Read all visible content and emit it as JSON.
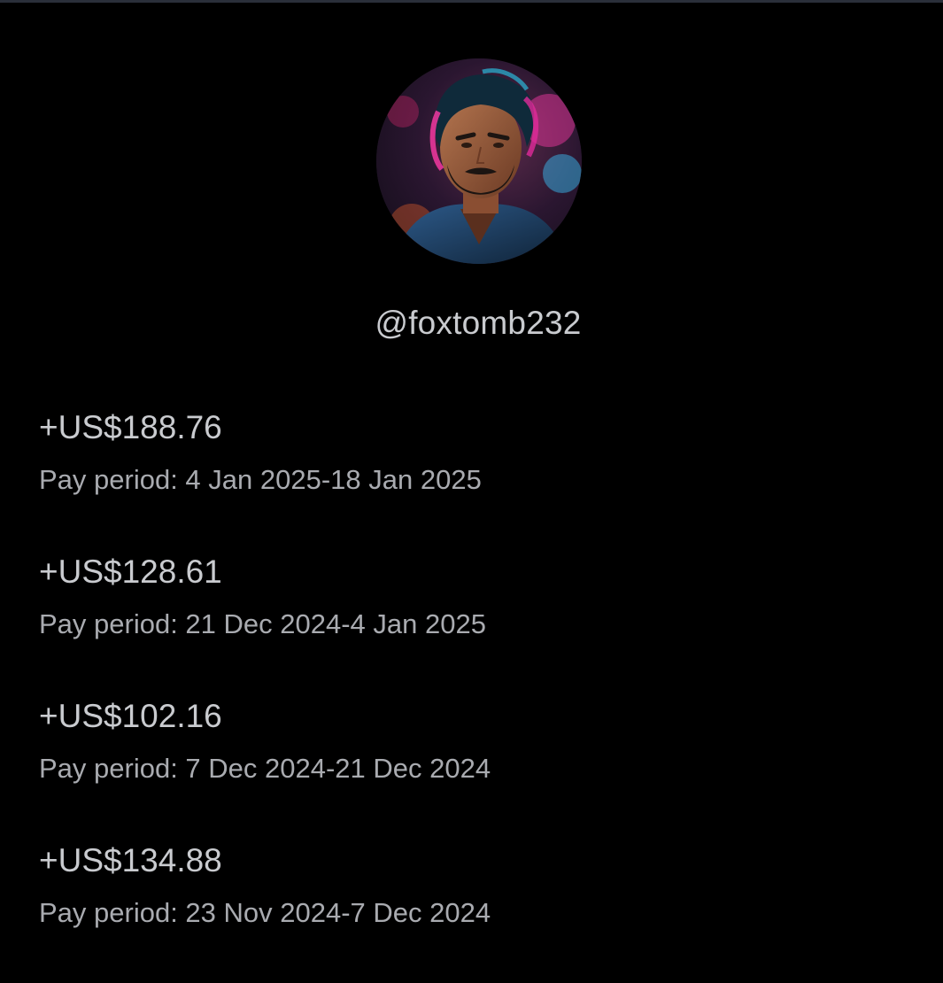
{
  "profile": {
    "avatar_icon": "avatar-illustration",
    "username": "@foxtomb232"
  },
  "payouts": [
    {
      "amount": "+US$188.76",
      "period": "Pay period: 4 Jan 2025-18 Jan 2025"
    },
    {
      "amount": "+US$128.61",
      "period": "Pay period: 21 Dec 2024-4 Jan 2025"
    },
    {
      "amount": "+US$102.16",
      "period": "Pay period: 7 Dec 2024-21 Dec 2024"
    },
    {
      "amount": "+US$134.88",
      "period": "Pay period: 23 Nov 2024-7 Dec 2024"
    }
  ],
  "colors": {
    "background": "#000000",
    "text_primary": "#c9cbcf",
    "text_secondary": "#a9abb0"
  }
}
